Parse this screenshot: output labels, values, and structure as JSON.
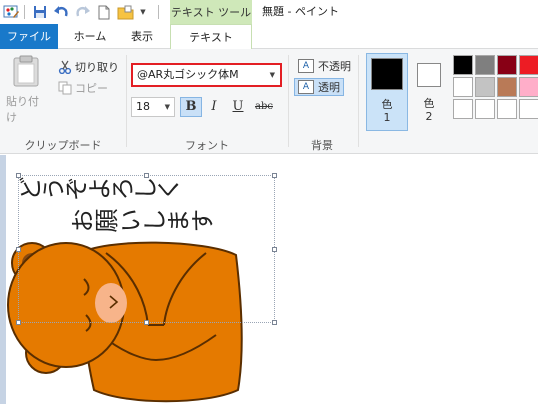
{
  "window": {
    "title": "無題 - ペイント",
    "context_header": "テキスト ツール"
  },
  "quick_access": {
    "icons": [
      "paint-app-icon",
      "save-icon",
      "undo-icon",
      "redo-icon",
      "new-document-icon",
      "folder-icon",
      "customize-dropdown-icon"
    ]
  },
  "tabs": {
    "file": "ファイル",
    "home": "ホーム",
    "view": "表示",
    "text": "テキスト"
  },
  "clipboard": {
    "paste": "貼り付け",
    "cut": "切り取り",
    "copy": "コピー",
    "group_label": "クリップボード"
  },
  "font": {
    "family": "@AR丸ゴシック体M",
    "size": "18",
    "bold": "B",
    "italic": "I",
    "underline": "U",
    "strikethrough": "abc",
    "group_label": "フォント"
  },
  "background": {
    "opaque": "不透明",
    "transparent": "透明",
    "group_label": "背景"
  },
  "colors": {
    "color1_label": "色\n1",
    "color1_a": "色",
    "color1_b": "1",
    "color2_a": "色",
    "color2_b": "2",
    "color1_value": "#000000",
    "color2_value": "#ffffff",
    "palette": [
      "#000000",
      "#7f7f7f",
      "#880015",
      "#ed1c24",
      "#ff7f27",
      "#ffffff",
      "#c3c3c3",
      "#b97a57",
      "#ffaec9",
      "#ffc90e",
      "#ffffff",
      "#ffffff",
      "#ffffff",
      "#ffffff",
      "#ffffff"
    ]
  },
  "canvas": {
    "text_line1": "どうぞよろしく",
    "text_line2": "お願いします"
  }
}
